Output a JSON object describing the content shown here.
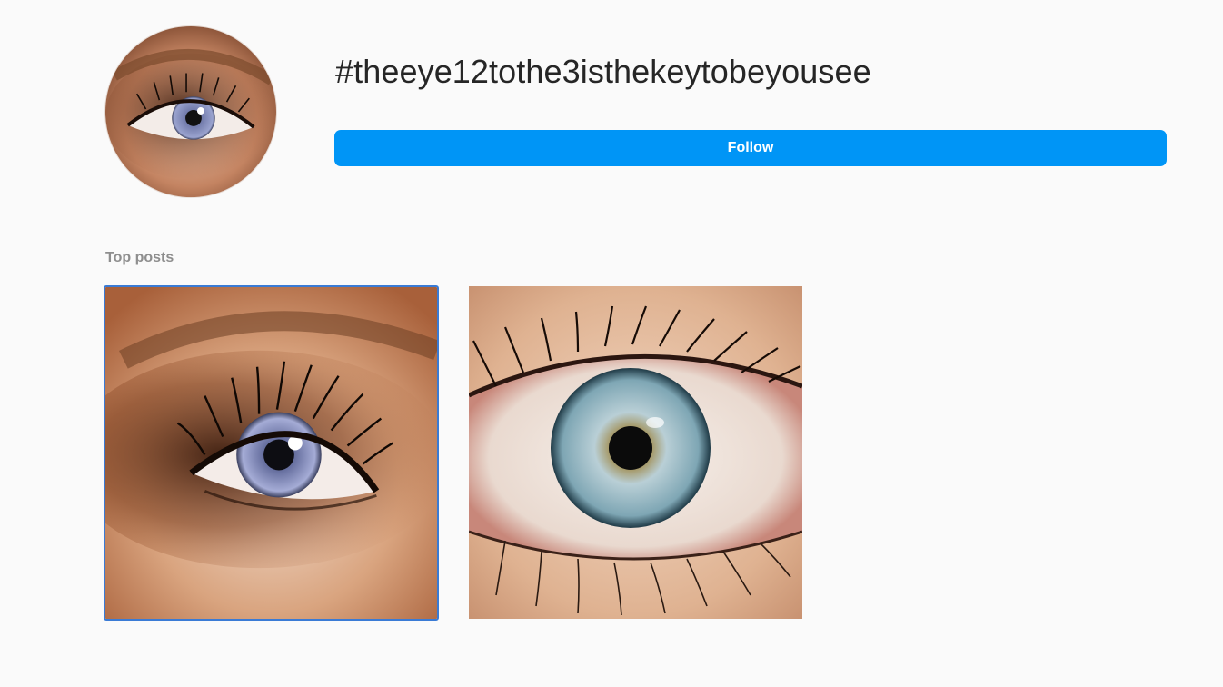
{
  "header": {
    "hashtag": "#theeye12tothe3isthekeytobeyousee",
    "follow_label": "Follow",
    "avatar_icon": "hashtag-avatar-eye-image"
  },
  "top_posts": {
    "label": "Top posts",
    "posts": [
      {
        "icon": "brown-smoky-eye-photo"
      },
      {
        "icon": "blue-eye-closeup-photo"
      }
    ]
  },
  "colors": {
    "background": "#fafafa",
    "follow_button": "#0095f6",
    "focus_border": "#3a7bd5",
    "muted_text": "#8e8e8e"
  }
}
